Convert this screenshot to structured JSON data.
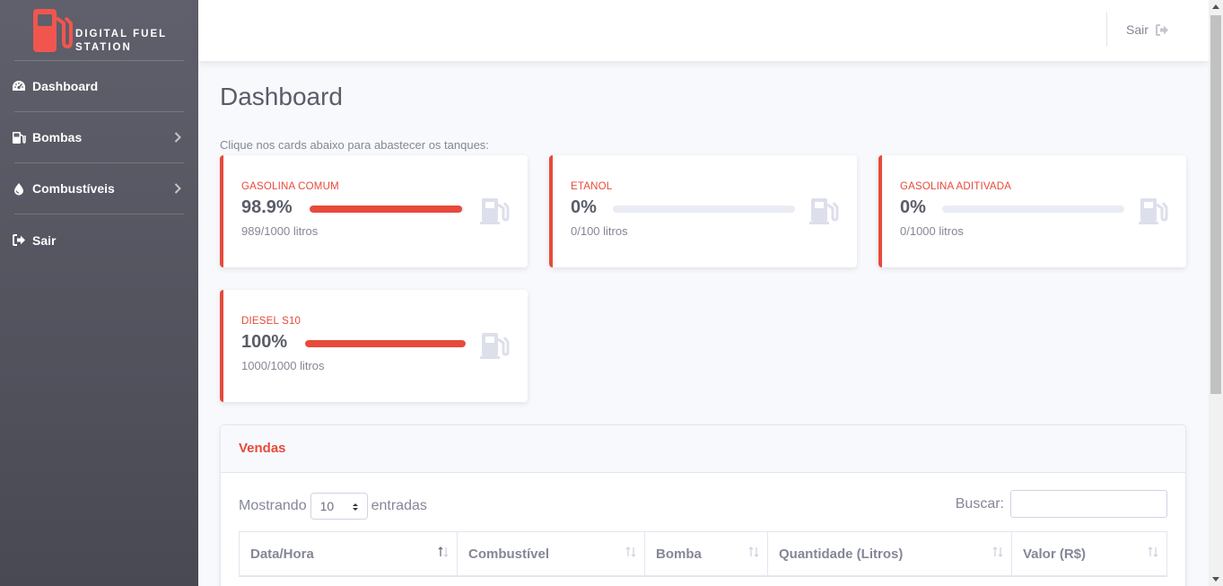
{
  "brand": {
    "line1": "DIGITAL FUEL",
    "line2": "STATION"
  },
  "sidebar": {
    "items": [
      {
        "label": "Dashboard",
        "icon": "tachometer-icon",
        "has_chevron": false
      },
      {
        "label": "Bombas",
        "icon": "gas-pump-icon",
        "has_chevron": true
      },
      {
        "label": "Combustíveis",
        "icon": "droplet-icon",
        "has_chevron": true
      },
      {
        "label": "Sair",
        "icon": "sign-out-icon",
        "has_chevron": false
      }
    ]
  },
  "topbar": {
    "logout_label": "Sair",
    "logout_icon": "sign-out-icon"
  },
  "page": {
    "title": "Dashboard",
    "hint": "Clique nos cards abaixo para abastecer os tanques:"
  },
  "tanks": [
    {
      "label": "GASOLINA COMUM",
      "percent_text": "98.9%",
      "fill": 0.989,
      "liters": "989/1000 litros"
    },
    {
      "label": "ETANOL",
      "percent_text": "0%",
      "fill": 0,
      "liters": "0/100 litros"
    },
    {
      "label": "GASOLINA ADITIVADA",
      "percent_text": "0%",
      "fill": 0,
      "liters": "0/1000 litros"
    },
    {
      "label": "DIESEL S10",
      "percent_text": "100%",
      "fill": 1.0,
      "liters": "1000/1000 litros"
    }
  ],
  "sales": {
    "title": "Vendas",
    "length_prefix": "Mostrando",
    "length_value": "10",
    "length_suffix": "entradas",
    "search_label": "Buscar:",
    "search_value": "",
    "columns": [
      "Data/Hora",
      "Combustível",
      "Bomba",
      "Quantidade (Litros)",
      "Valor (R$)"
    ]
  },
  "colors": {
    "accent": "#e74a3b",
    "sidebar_top": "#5f606b",
    "sidebar_bottom": "#484953",
    "muted_icon": "#dddfeb"
  }
}
